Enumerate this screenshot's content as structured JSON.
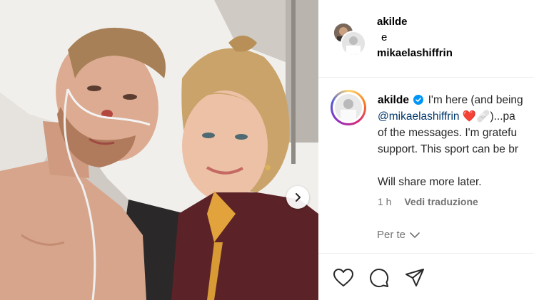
{
  "header": {
    "user1": "akilde",
    "conjunction": "e",
    "user2": "mikaelashiffrin"
  },
  "post": {
    "username": "akilde",
    "line1": "I'm here (and being",
    "mention": "@mikaelashiffrin",
    "line2_emoji": "❤️🩹",
    "line2_rest": ")...pa",
    "line3": "of the messages. I'm gratefu",
    "line4": "support. This sport can be br",
    "line5": "Will share more later."
  },
  "meta": {
    "time": "1 h",
    "translate": "Vedi traduzione"
  },
  "for_you": {
    "label": "Per te"
  },
  "icons": {
    "verified": "verified-badge-icon",
    "next": "chevron-right-icon",
    "like": "heart-icon",
    "comment": "comment-bubble-icon",
    "share": "send-icon",
    "dropdown": "chevron-down-icon"
  },
  "colors": {
    "mention": "#00376b",
    "verified": "#0095f6",
    "muted": "#737373"
  }
}
